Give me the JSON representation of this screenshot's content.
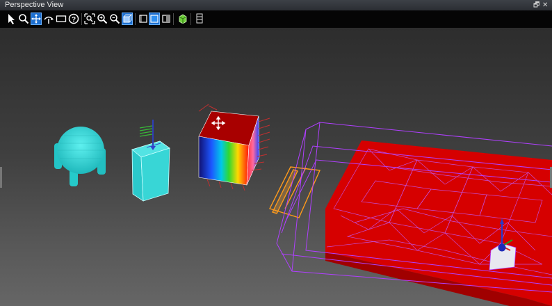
{
  "window": {
    "title": "Perspective View",
    "restore_glyph": "🗗",
    "close_glyph": "✕"
  },
  "toolbar": {
    "icons": [
      "select-arrow-icon",
      "zoom-icon",
      "pan-icon",
      "orbit-icon",
      "rectangle-select-icon",
      "help-icon",
      "zoom-extents-icon",
      "zoom-in-icon",
      "zoom-out-icon",
      "view-cube-icon",
      "wireframe-box-icon",
      "solid-box-icon",
      "shaded-box-icon",
      "mesh-cube-icon",
      "grid-page-icon"
    ],
    "active": [
      "pan-icon",
      "view-cube-icon",
      "solid-box-icon"
    ],
    "help_glyph": "?"
  },
  "scene": {
    "background_top": "#2d2d2d",
    "background_bottom": "#666666",
    "objects": [
      "sphere-object",
      "box-object",
      "gradient-cube-object",
      "plate-object",
      "mesh-plate-object",
      "gizmo-object"
    ],
    "colors": {
      "cyan": "#2ad6d6",
      "red_mesh": "#e00000",
      "purple_wire": "#b040ff",
      "orange_wire": "#ff9a1a",
      "gradient": [
        "#ff0000",
        "#ffcc00",
        "#33dd33",
        "#00ccee",
        "#2244ff",
        "#101080"
      ]
    }
  }
}
